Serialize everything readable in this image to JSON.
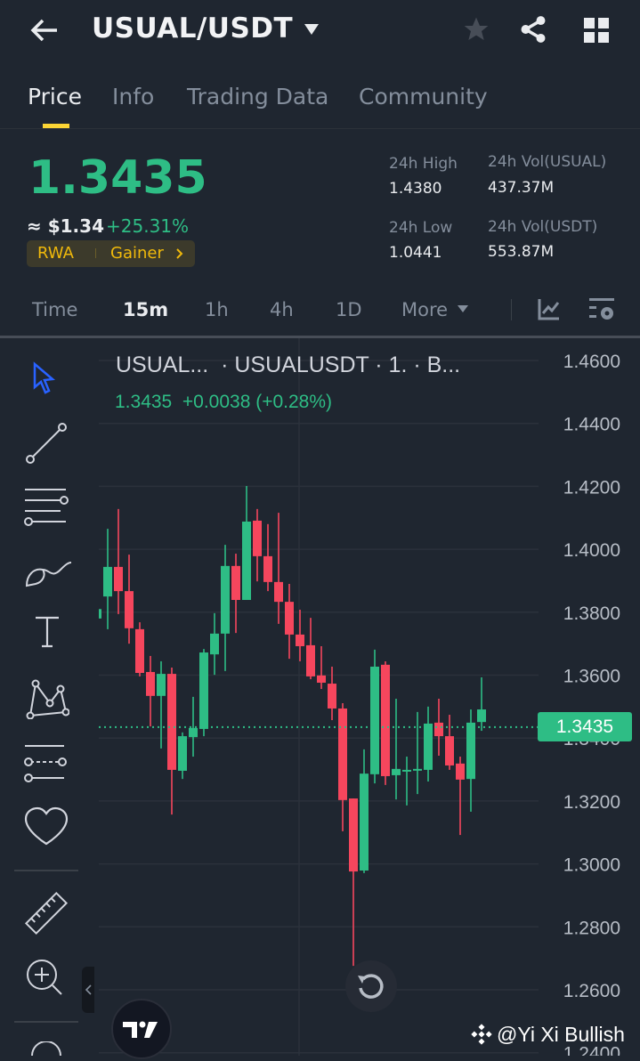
{
  "header": {
    "title": "USUAL/USDT"
  },
  "tabs": [
    {
      "label": "Price"
    },
    {
      "label": "Info"
    },
    {
      "label": "Trading Data"
    },
    {
      "label": "Community"
    }
  ],
  "ticker": {
    "last": "1.3435",
    "usd": "≈ $1.34",
    "change": "+25.31%",
    "tag1": "RWA",
    "tag2": "Gainer",
    "high_label": "24h High",
    "high": "1.4380",
    "low_label": "24h Low",
    "low": "1.0441",
    "vol_base_label": "24h Vol(USUAL)",
    "vol_base": "437.37M",
    "vol_quote_label": "24h Vol(USDT)",
    "vol_quote": "553.87M"
  },
  "timeframes": [
    {
      "label": "Time"
    },
    {
      "label": "15m"
    },
    {
      "label": "1h"
    },
    {
      "label": "4h"
    },
    {
      "label": "1D"
    },
    {
      "label": "More"
    }
  ],
  "chart": {
    "legend_title": "USUAL...  · USUALUSDT · 1. · B...",
    "legend_values": "1.3435  +0.0038 (+0.28%)",
    "current_price": "1.3435",
    "watermark": "@Yi Xi Bullish"
  },
  "colors": {
    "up": "#2ebd85",
    "down": "#f6465d",
    "accent": "#fcd535",
    "bg": "#1f2630"
  },
  "chart_data": {
    "type": "candlestick",
    "ylim": [
      1.24,
      1.46
    ],
    "yticks": [
      "1.4600",
      "1.4400",
      "1.4200",
      "1.4000",
      "1.3800",
      "1.3600",
      "1.3400",
      "1.3200",
      "1.3000",
      "1.2800",
      "1.2600",
      "1.2400"
    ],
    "current": 1.3435,
    "candles": [
      [
        1.378,
        1.385,
        1.3717,
        1.381
      ],
      [
        1.385,
        1.4065,
        1.3746,
        1.3944
      ],
      [
        1.3944,
        1.4128,
        1.3794,
        1.3867
      ],
      [
        1.3867,
        1.3983,
        1.37,
        1.3749
      ],
      [
        1.3746,
        1.3768,
        1.3596,
        1.3607
      ],
      [
        1.361,
        1.3661,
        1.3437,
        1.3534
      ],
      [
        1.3534,
        1.3644,
        1.3367,
        1.3604
      ],
      [
        1.3604,
        1.3624,
        1.3157,
        1.3299
      ],
      [
        1.3296,
        1.3418,
        1.327,
        1.3406
      ],
      [
        1.3403,
        1.3531,
        1.3341,
        1.3432
      ],
      [
        1.3429,
        1.3683,
        1.3406,
        1.3672
      ],
      [
        1.3666,
        1.3797,
        1.3601,
        1.3732
      ],
      [
        1.3732,
        1.4014,
        1.3613,
        1.3947
      ],
      [
        1.3947,
        1.3986,
        1.3734,
        1.3839
      ],
      [
        1.3839,
        1.4201,
        1.3839,
        1.4088
      ],
      [
        1.4091,
        1.4128,
        1.3898,
        1.3978
      ],
      [
        1.3978,
        1.408,
        1.3867,
        1.3896
      ],
      [
        1.3896,
        1.4116,
        1.3763,
        1.3833
      ],
      [
        1.3833,
        1.389,
        1.3652,
        1.3729
      ],
      [
        1.3729,
        1.3808,
        1.3644,
        1.3692
      ],
      [
        1.3695,
        1.3782,
        1.3587,
        1.3596
      ],
      [
        1.3599,
        1.3692,
        1.3556,
        1.3576
      ],
      [
        1.3573,
        1.3627,
        1.3457,
        1.3494
      ],
      [
        1.3494,
        1.3511,
        1.3104,
        1.3203
      ],
      [
        1.3208,
        1.3208,
        1.2676,
        1.2976
      ],
      [
        1.2979,
        1.3364,
        1.2971,
        1.3287
      ],
      [
        1.3285,
        1.3681,
        1.3256,
        1.3627
      ],
      [
        1.3633,
        1.3644,
        1.3251,
        1.3279
      ],
      [
        1.3282,
        1.3525,
        1.3205,
        1.3302
      ],
      [
        1.3296,
        1.3341,
        1.3186,
        1.3299
      ],
      [
        1.3299,
        1.3483,
        1.3222,
        1.3302
      ],
      [
        1.3299,
        1.35,
        1.3262,
        1.3446
      ],
      [
        1.3449,
        1.3525,
        1.3344,
        1.3406
      ],
      [
        1.3406,
        1.3474,
        1.3299,
        1.3313
      ],
      [
        1.3319,
        1.3341,
        1.3092,
        1.3268
      ],
      [
        1.327,
        1.3491,
        1.3166,
        1.3449
      ],
      [
        1.3451,
        1.3593,
        1.3423,
        1.3491
      ]
    ]
  }
}
